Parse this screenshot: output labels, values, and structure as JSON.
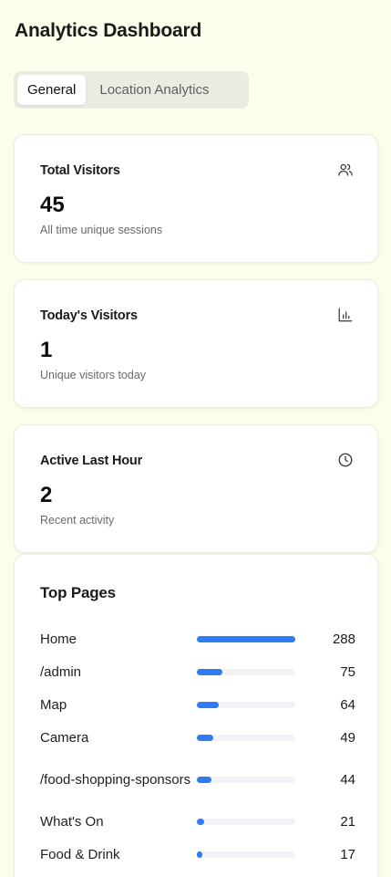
{
  "header": {
    "title": "Analytics Dashboard"
  },
  "tabs": [
    {
      "label": "General",
      "active": true
    },
    {
      "label": "Location Analytics",
      "active": false
    }
  ],
  "stats": [
    {
      "title": "Total Visitors",
      "value": "45",
      "subtitle": "All time unique sessions",
      "icon": "users-icon"
    },
    {
      "title": "Today's Visitors",
      "value": "1",
      "subtitle": "Unique visitors today",
      "icon": "bar-chart-icon"
    },
    {
      "title": "Active Last Hour",
      "value": "2",
      "subtitle": "Recent activity",
      "icon": "clock-icon"
    }
  ],
  "top_pages": {
    "title": "Top Pages",
    "bar_color": "#2e7cf0",
    "track_color": "#f1f3f6",
    "items": [
      {
        "name": "Home",
        "count": "288",
        "fraction": 1.0
      },
      {
        "name": "/admin",
        "count": "75",
        "fraction": 0.26
      },
      {
        "name": "Map",
        "count": "64",
        "fraction": 0.22
      },
      {
        "name": "Camera",
        "count": "49",
        "fraction": 0.17
      },
      {
        "name": "/food-shopping-sponsors",
        "count": "44",
        "fraction": 0.15
      },
      {
        "name": "What's On",
        "count": "21",
        "fraction": 0.07
      },
      {
        "name": "Food & Drink",
        "count": "17",
        "fraction": 0.06
      }
    ]
  },
  "colors": {
    "background": "#fdfdeb",
    "accent": "#2e7cf0"
  }
}
